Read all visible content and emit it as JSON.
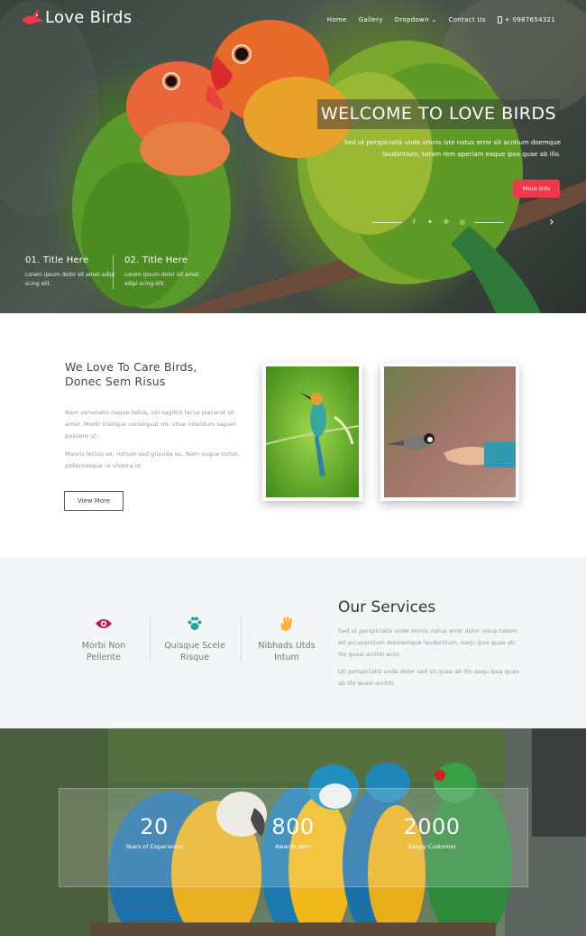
{
  "header": {
    "logo_text": "Love Birds",
    "nav": [
      "Home",
      "Gallery",
      "Dropdown",
      "Contact Us"
    ],
    "phone": "+ 0987654321"
  },
  "hero": {
    "title": "WELCOME TO LOVE BIRDS",
    "subtitle": "Sed ut perspiciatis unde omnis iste natus error sit acntium doemque laudantium, totam rem aperiam eaque ipsa quae ab illo.",
    "button": "More Info",
    "social_icons": [
      "facebook-icon",
      "twitter-icon",
      "pinterest-icon",
      "instagram-icon"
    ],
    "features": [
      {
        "title": "01. Title Here",
        "text": "Lorem ipsum dolor sit amet adipi scing elit."
      },
      {
        "title": "02. Title Here",
        "text": "Lorem ipsum dolor sit amet adipi scing elit."
      }
    ]
  },
  "about": {
    "title_line1": "We Love To Care Birds,",
    "title_line2": "Donec Sem Risus",
    "para1": "Nam venenatis neque tellus, vel sagittis lacus placerat sit amet. Morbi tristique consequat mi, vitae interdum sapien posuere ut.",
    "para2": "Mauris lectus ex, rutrum sed gravida eu, Nam augue tortor, pellentesque ut viverra id.",
    "button": "View More"
  },
  "services": {
    "items": [
      {
        "label_line1": "Morbi Non",
        "label_line2": "Pellente",
        "icon": "eye-icon",
        "color": "#c2185b"
      },
      {
        "label_line1": "Quisque Scele",
        "label_line2": "Risque",
        "icon": "paw-icon",
        "color": "#26a69a"
      },
      {
        "label_line1": "Nibhads Utds",
        "label_line2": "Intum",
        "icon": "hand-icon",
        "color": "#f9b233"
      }
    ],
    "title": "Our Services",
    "para1": "Sed ut perspiciatis unde omnis natus error dolor volup tatem ed accusantium doloremque laudantium, eaqu ipsa quae ab illo quasi architi ecto.",
    "para2": "Uti perspiciatis unde dolor sed sit quae ab illo eaqu ipsa quae ab illo quasi architi."
  },
  "stats": [
    {
      "number": "20",
      "label": "Years of Experience"
    },
    {
      "number": "800",
      "label": "Awards Won"
    },
    {
      "number": "2000",
      "label": "Happy Customer"
    }
  ],
  "colors": {
    "accent": "#f2374b"
  }
}
